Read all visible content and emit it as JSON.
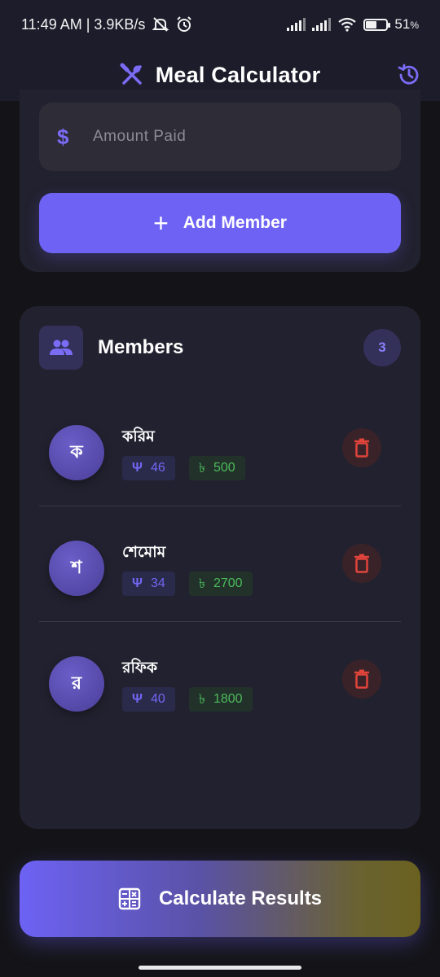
{
  "status_bar": {
    "time_speed": "11:49 AM | 3.9KB/s",
    "battery": "51",
    "battery_unit": "%",
    "battery_level": 0.51
  },
  "header": {
    "title": "Meal Calculator",
    "logo_icon": "fork-spoon-icon",
    "history_icon": "history-icon",
    "accent": "#6d62f4"
  },
  "form": {
    "amount_placeholder": "Amount Paid",
    "amount_value": "",
    "amount_icon": "$",
    "add_member_icon": "+",
    "add_member_label": "Add Member"
  },
  "members": {
    "title": "Members",
    "count": "3",
    "items": [
      {
        "initial": "ক",
        "name": "করিম",
        "meal_icon": "Ψ",
        "meals": "46",
        "currency": "৳",
        "amount": "500"
      },
      {
        "initial": "শ",
        "name": "শেমোম",
        "meal_icon": "Ψ",
        "meals": "34",
        "currency": "৳",
        "amount": "2700"
      },
      {
        "initial": "র",
        "name": "রফিক",
        "meal_icon": "Ψ",
        "meals": "40",
        "currency": "৳",
        "amount": "1800"
      }
    ]
  },
  "calculate": {
    "label": "Calculate Results"
  },
  "colors": {
    "meal_chip": "#7266f2",
    "money_chip": "#4cba5a",
    "delete": "#e0443a"
  }
}
